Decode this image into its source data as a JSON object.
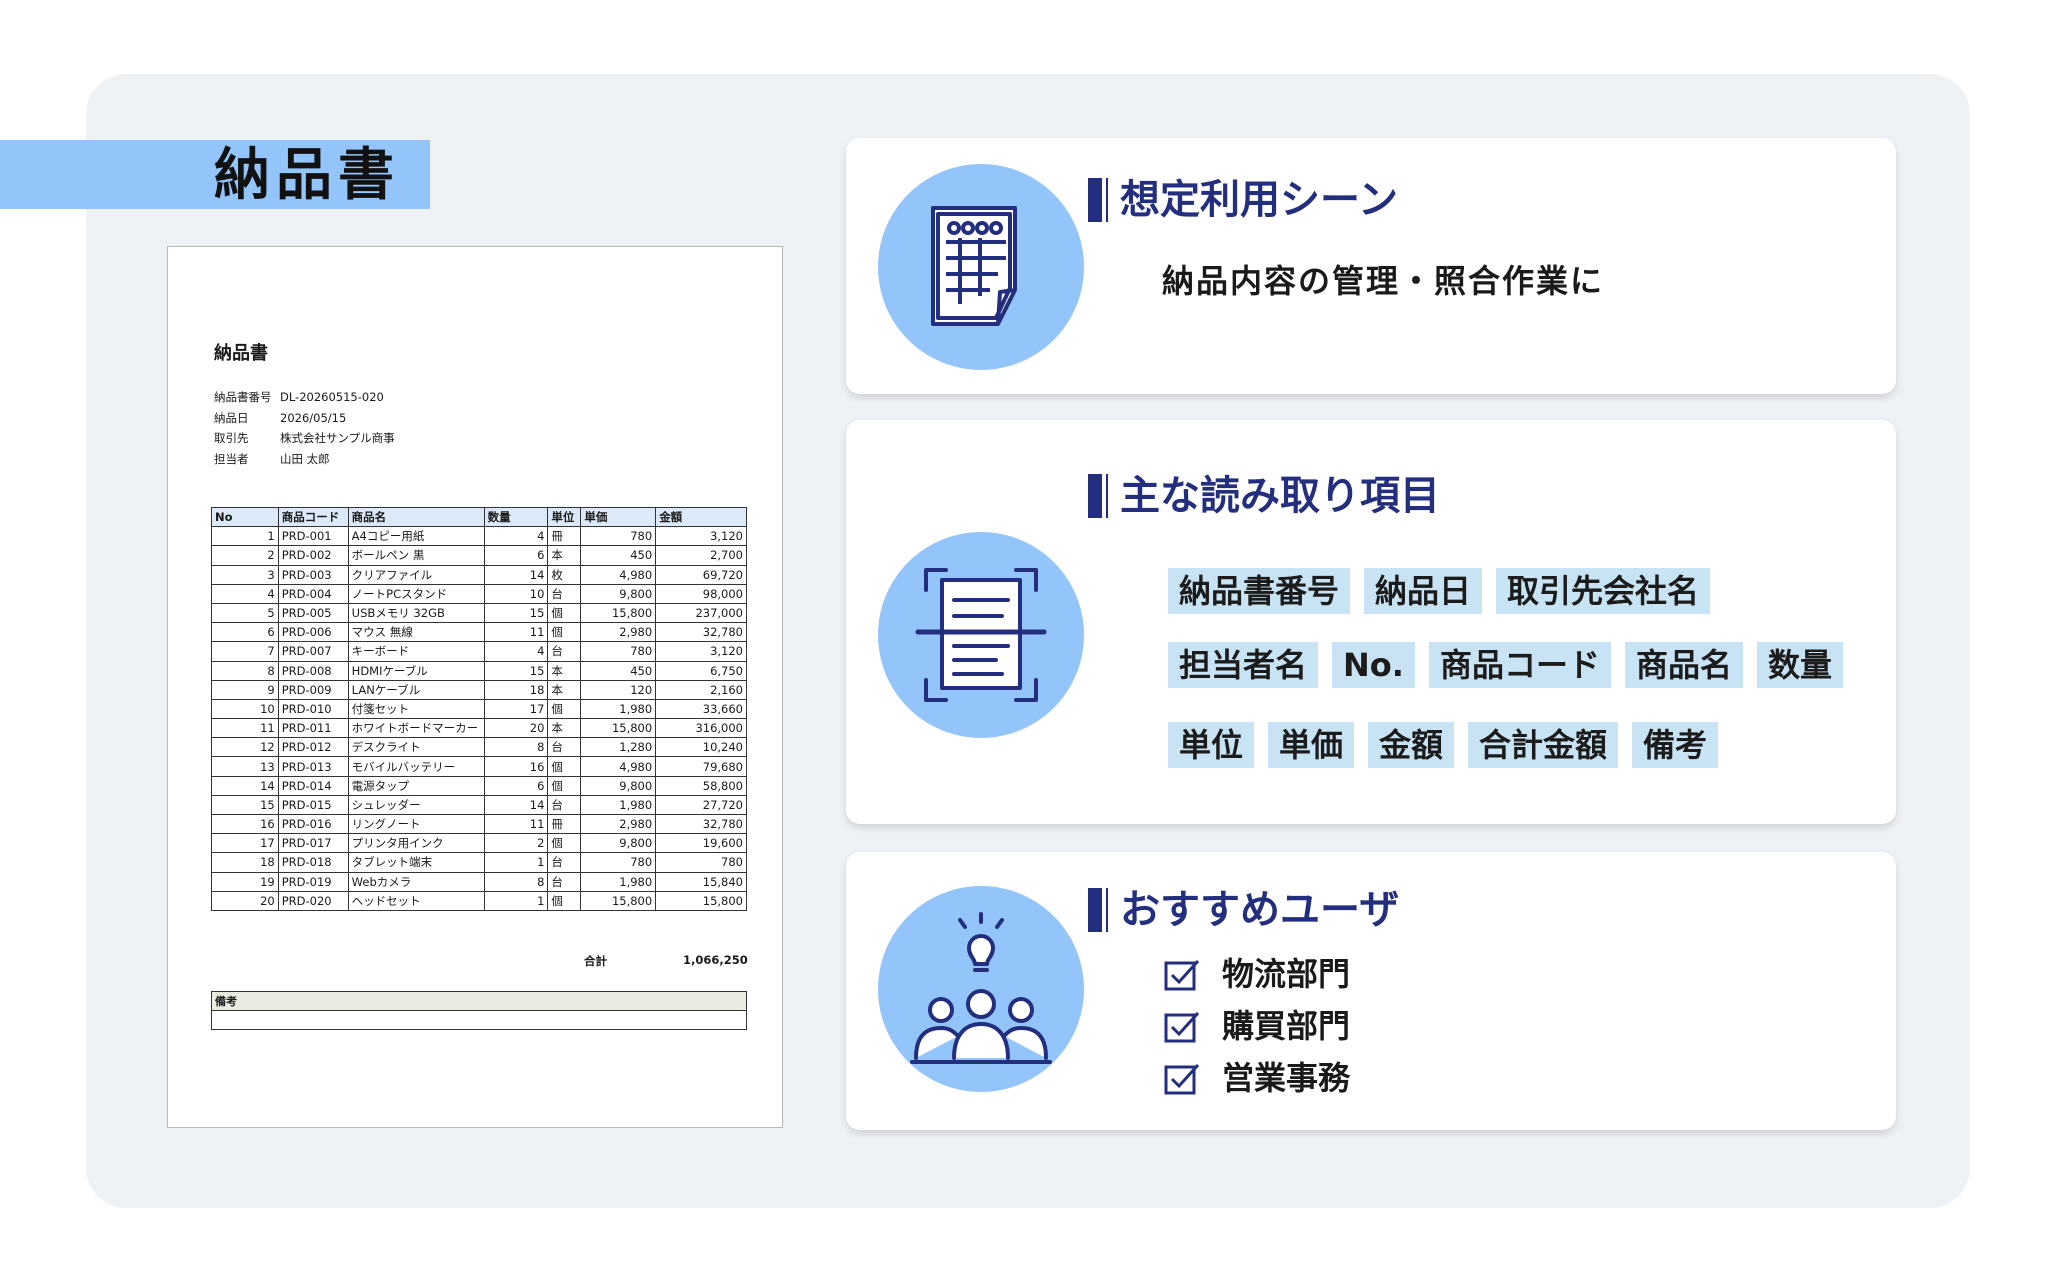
{
  "page_title": "納品書",
  "document": {
    "title": "納品書",
    "meta": [
      {
        "label": "納品書番号",
        "value": "DL-20260515-020"
      },
      {
        "label": "納品日",
        "value": "2026/05/15"
      },
      {
        "label": "取引先",
        "value": "株式会社サンプル商事"
      },
      {
        "label": "担当者",
        "value": "山田 太郎"
      }
    ],
    "columns": [
      "No",
      "商品コード",
      "商品名",
      "数量",
      "単位",
      "単価",
      "金額"
    ],
    "rows": [
      [
        "1",
        "PRD-001",
        "A4コピー用紙",
        "4",
        "冊",
        "780",
        "3,120"
      ],
      [
        "2",
        "PRD-002",
        "ボールペン 黒",
        "6",
        "本",
        "450",
        "2,700"
      ],
      [
        "3",
        "PRD-003",
        "クリアファイル",
        "14",
        "枚",
        "4,980",
        "69,720"
      ],
      [
        "4",
        "PRD-004",
        "ノートPCスタンド",
        "10",
        "台",
        "9,800",
        "98,000"
      ],
      [
        "5",
        "PRD-005",
        "USBメモリ 32GB",
        "15",
        "個",
        "15,800",
        "237,000"
      ],
      [
        "6",
        "PRD-006",
        "マウス 無線",
        "11",
        "個",
        "2,980",
        "32,780"
      ],
      [
        "7",
        "PRD-007",
        "キーボード",
        "4",
        "台",
        "780",
        "3,120"
      ],
      [
        "8",
        "PRD-008",
        "HDMIケーブル",
        "15",
        "本",
        "450",
        "6,750"
      ],
      [
        "9",
        "PRD-009",
        "LANケーブル",
        "18",
        "本",
        "120",
        "2,160"
      ],
      [
        "10",
        "PRD-010",
        "付箋セット",
        "17",
        "個",
        "1,980",
        "33,660"
      ],
      [
        "11",
        "PRD-011",
        "ホワイトボードマーカー",
        "20",
        "本",
        "15,800",
        "316,000"
      ],
      [
        "12",
        "PRD-012",
        "デスクライト",
        "8",
        "台",
        "1,280",
        "10,240"
      ],
      [
        "13",
        "PRD-013",
        "モバイルバッテリー",
        "16",
        "個",
        "4,980",
        "79,680"
      ],
      [
        "14",
        "PRD-014",
        "電源タップ",
        "6",
        "個",
        "9,800",
        "58,800"
      ],
      [
        "15",
        "PRD-015",
        "シュレッダー",
        "14",
        "台",
        "1,980",
        "27,720"
      ],
      [
        "16",
        "PRD-016",
        "リングノート",
        "11",
        "冊",
        "2,980",
        "32,780"
      ],
      [
        "17",
        "PRD-017",
        "プリンタ用インク",
        "2",
        "個",
        "9,800",
        "19,600"
      ],
      [
        "18",
        "PRD-018",
        "タブレット端末",
        "1",
        "台",
        "780",
        "780"
      ],
      [
        "19",
        "PRD-019",
        "Webカメラ",
        "8",
        "台",
        "1,980",
        "15,840"
      ],
      [
        "20",
        "PRD-020",
        "ヘッドセット",
        "1",
        "個",
        "15,800",
        "15,800"
      ]
    ],
    "total_label": "合計",
    "total_value": "1,066,250",
    "remarks_label": "備考",
    "remarks_value": ""
  },
  "scene": {
    "heading": "想定利用シーン",
    "text": "納品内容の管理・照合作業に",
    "icon": "spreadsheet-document-icon"
  },
  "fields": {
    "heading": "主な読み取り項目",
    "icon": "document-scan-icon",
    "tags": [
      "納品書番号",
      "納品日",
      "取引先会社名",
      "担当者名",
      "No.",
      "商品コード",
      "商品名",
      "数量",
      "単位",
      "単価",
      "金額",
      "合計金額",
      "備考"
    ]
  },
  "users": {
    "heading": "おすすめユーザ",
    "icon": "team-idea-icon",
    "items": [
      "物流部門",
      "購買部門",
      "営業事務"
    ]
  },
  "colors": {
    "accent": "#232f7e",
    "circle": "#93c5fb",
    "tag_bg": "#c8e3f4",
    "panel_bg": "#eff2f5"
  }
}
